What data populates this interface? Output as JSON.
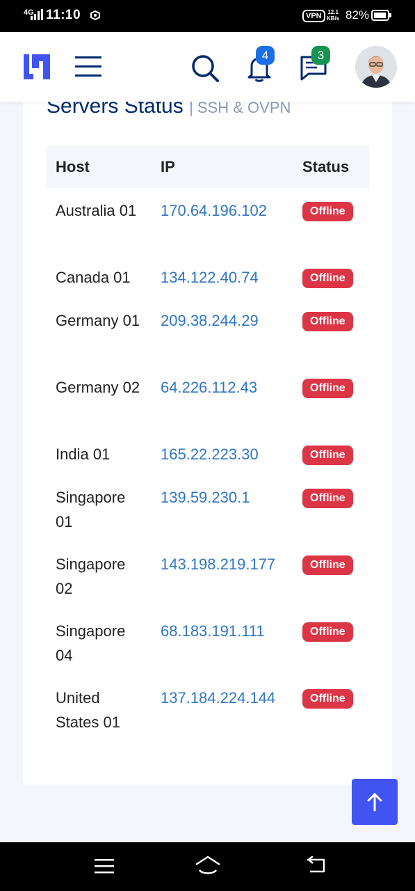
{
  "status_bar": {
    "network": "4G",
    "time": "11:10",
    "vpn": "VPN",
    "speed_value": "12.1",
    "speed_unit": "KB/s",
    "battery": "82%"
  },
  "header": {
    "notifications_count": "4",
    "messages_count": "3"
  },
  "card": {
    "title": "Servers Status",
    "subtitle": "| SSH & OVPN"
  },
  "table": {
    "columns": [
      "Host",
      "IP",
      "Status"
    ],
    "rows": [
      {
        "host": "Australia 01",
        "ip": "170.64.196.102",
        "status": "Offline"
      },
      {
        "host": "Canada 01",
        "ip": "134.122.40.74",
        "status": "Offline"
      },
      {
        "host": "Germany 01",
        "ip": "209.38.244.29",
        "status": "Offline"
      },
      {
        "host": "Germany 02",
        "ip": "64.226.112.43",
        "status": "Offline"
      },
      {
        "host": "India 01",
        "ip": "165.22.223.30",
        "status": "Offline"
      },
      {
        "host": "Singapore 01",
        "ip": "139.59.230.1",
        "status": "Offline"
      },
      {
        "host": "Singapore 02",
        "ip": "143.198.219.177",
        "status": "Offline"
      },
      {
        "host": "Singapore 04",
        "ip": "68.183.191.111",
        "status": "Offline"
      },
      {
        "host": "United States 01",
        "ip": "137.184.224.144",
        "status": "Offline"
      }
    ]
  },
  "colors": {
    "accent": "#4154f1",
    "title": "#012970",
    "offline_badge": "#dc3545",
    "ip_link": "#2f76c2"
  }
}
